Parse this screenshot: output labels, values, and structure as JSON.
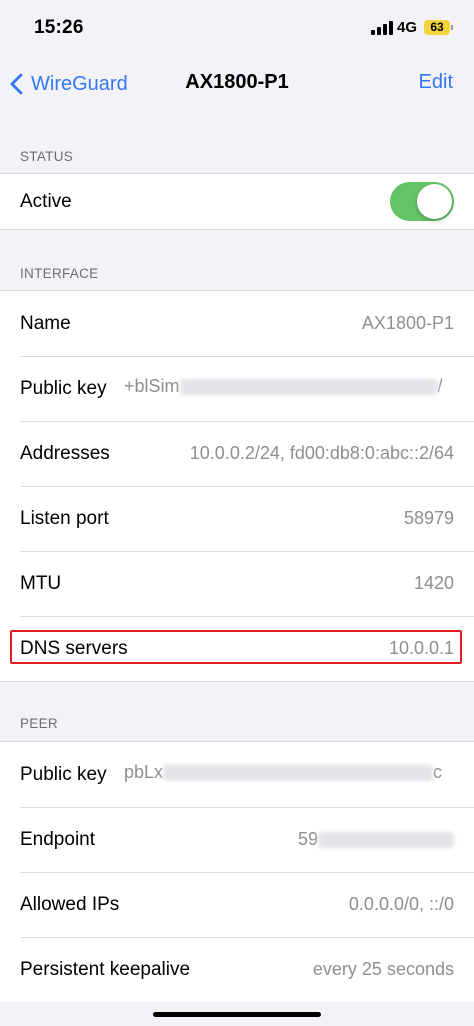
{
  "status_bar": {
    "time": "15:26",
    "network": "4G",
    "battery": "63"
  },
  "nav": {
    "back_label": "WireGuard",
    "title": "AX1800-P1",
    "edit_label": "Edit"
  },
  "status": {
    "header": "STATUS",
    "active_label": "Active",
    "active_on": true
  },
  "interface": {
    "header": "INTERFACE",
    "name_label": "Name",
    "name_value": "AX1800-P1",
    "public_key_label": "Public key",
    "public_key_visible": "+blSim",
    "public_key_tail": "/",
    "addresses_label": "Addresses",
    "addresses_value": "10.0.0.2/24, fd00:db8:0:abc::2/64",
    "listen_port_label": "Listen port",
    "listen_port_value": "58979",
    "mtu_label": "MTU",
    "mtu_value": "1420",
    "dns_label": "DNS servers",
    "dns_value": "10.0.0.1"
  },
  "peer": {
    "header": "PEER",
    "public_key_label": "Public key",
    "public_key_visible": "pbLx",
    "public_key_tail": "c",
    "endpoint_label": "Endpoint",
    "endpoint_visible": "59",
    "allowed_ips_label": "Allowed IPs",
    "allowed_ips_value": "0.0.0.0/0, ::/0",
    "keepalive_label": "Persistent keepalive",
    "keepalive_value": "every 25 seconds"
  },
  "colors": {
    "accent": "#3478f6",
    "toggle_on": "#65c466",
    "highlight": "#e11d24"
  }
}
